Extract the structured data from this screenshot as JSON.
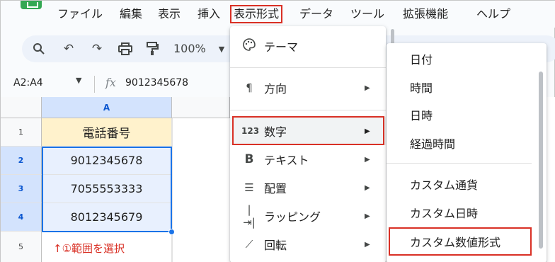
{
  "menubar": {
    "items": [
      "ファイル",
      "編集",
      "表示",
      "挿入",
      "表示形式",
      "データ",
      "ツール",
      "拡張機能",
      "ヘルプ"
    ]
  },
  "toolbar": {
    "icons": [
      "search-icon",
      "undo-icon",
      "redo-icon",
      "print-icon",
      "paint-format-icon"
    ],
    "zoom": "100%"
  },
  "formula_bar": {
    "name_box": "A2:A4",
    "fx": "fx",
    "value": "9012345678"
  },
  "grid": {
    "column_header": "A",
    "row_numbers": [
      "1",
      "2",
      "3",
      "4",
      "5"
    ],
    "cells": [
      "電話番号",
      "9012345678",
      "7055553333",
      "8012345679"
    ],
    "note": "↑①範囲を選択"
  },
  "format_menu": {
    "items": [
      {
        "icon": "palette-icon",
        "label": "テーマ",
        "has_submenu": false
      },
      {
        "icon": "text-direction-icon",
        "label": "方向",
        "has_submenu": true
      },
      {
        "icon": "number-123-icon",
        "label": "数字",
        "has_submenu": true,
        "active": true
      },
      {
        "icon": "bold-icon",
        "label": "テキスト",
        "has_submenu": true
      },
      {
        "icon": "align-icon",
        "label": "配置",
        "has_submenu": true
      },
      {
        "icon": "wrap-icon",
        "label": "ラッピング",
        "has_submenu": true
      },
      {
        "icon": "rotate-icon",
        "label": "回転",
        "has_submenu": true
      }
    ]
  },
  "number_submenu": {
    "items": [
      "日付",
      "時間",
      "日時",
      "経過時間",
      "カスタム通貨",
      "カスタム日時",
      "カスタム数値形式"
    ],
    "highlighted": "カスタム数値形式"
  },
  "colors": {
    "highlight_red": "#d93025",
    "selection_blue": "#1a73e8",
    "header_fill": "#fff2cc",
    "brand_green": "#34a853"
  }
}
